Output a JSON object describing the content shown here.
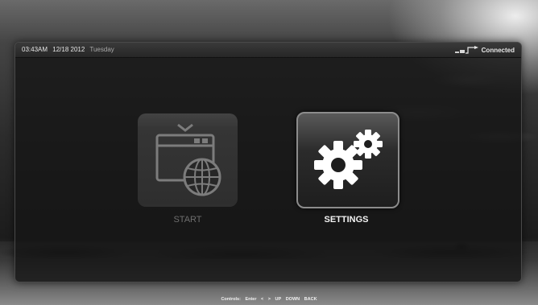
{
  "status_bar": {
    "time": "03:43AM",
    "date": "12/18 2012",
    "day": "Tuesday",
    "network_icon": "network-signal-icon",
    "network_status": "Connected"
  },
  "menu": {
    "items": [
      {
        "label": "START",
        "icon": "app-globe-icon",
        "selected": false
      },
      {
        "label": "SETTINGS",
        "icon": "gears-icon",
        "selected": true
      }
    ]
  },
  "footer": {
    "controls_label": "Controls:",
    "enter": "Enter",
    "left": "<",
    "right": ">",
    "up": "UP",
    "down": "DOWN",
    "back": "BACK"
  },
  "colors": {
    "selected_label": "#f2f2f2",
    "unselected_label": "#6e6e6e",
    "panel_bg": "#161616"
  }
}
